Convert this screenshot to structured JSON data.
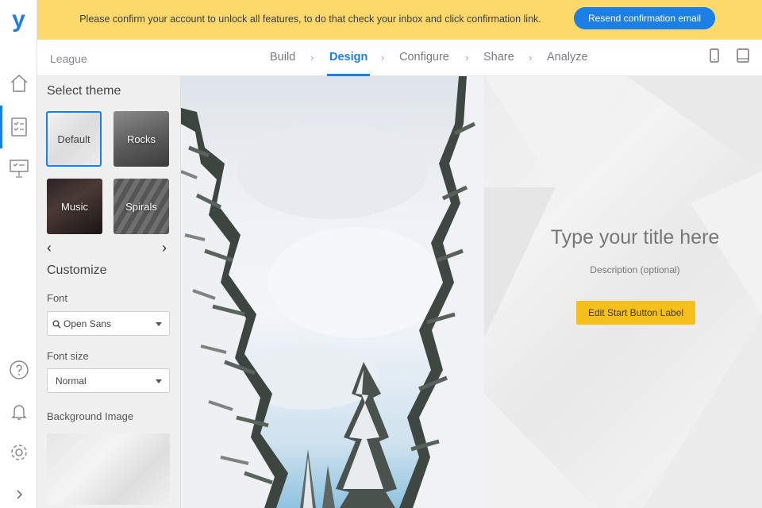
{
  "app": {
    "logo_letter": "y",
    "project_name": "League"
  },
  "banner": {
    "message": "Please confirm your account to unlock all features, to do that check your inbox and click confirmation link.",
    "resend_button": "Resend confirmation email"
  },
  "steps": [
    {
      "label": "Build",
      "active": false
    },
    {
      "label": "Design",
      "active": true
    },
    {
      "label": "Configure",
      "active": false
    },
    {
      "label": "Share",
      "active": false
    },
    {
      "label": "Analyze",
      "active": false
    }
  ],
  "step_separator": "›",
  "panel": {
    "select_theme_heading": "Select theme",
    "themes": [
      "Default",
      "Rocks",
      "Music",
      "Spirals"
    ],
    "selected_theme": "Default",
    "prev_arrow": "‹",
    "next_arrow": "›",
    "customize_heading": "Customize",
    "font_label": "Font",
    "font_value": "Open Sans",
    "font_size_label": "Font size",
    "font_size_value": "Normal",
    "background_image_label": "Background Image"
  },
  "preview": {
    "title_placeholder": "Type your title here",
    "description_placeholder": "Description (optional)",
    "start_button_label": "Edit Start Button Label"
  },
  "colors": {
    "accent": "#1b7fe6",
    "banner": "#fdd86a",
    "start_button": "#f5bf1c"
  },
  "icons": {
    "rail": [
      "home-icon",
      "form-list-icon",
      "presentation-icon",
      "help-icon",
      "bell-icon",
      "settings-icon",
      "expand-icon"
    ],
    "devices": [
      "mobile-icon",
      "tablet-icon"
    ]
  }
}
